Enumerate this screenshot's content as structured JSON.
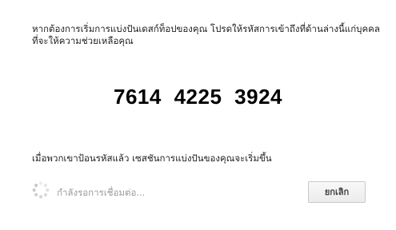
{
  "instruction": "หากต้องการเริ่มการแบ่งปันเดสก์ท็อปของคุณ โปรดให้รหัสการเข้าถึงที่ด้านล่างนี้แก่บุคคลที่จะให้ความช่วยเหลือคุณ",
  "access_code": {
    "groups": [
      "7614",
      "4225",
      "3924"
    ]
  },
  "after_note": "เมื่อพวกเขาป้อนรหัสแล้ว เซสชันการแบ่งปันของคุณจะเริ่มขึ้น",
  "status": {
    "text": "กำลังรอการเชื่อมต่อ...",
    "icon": "spinner-icon"
  },
  "buttons": {
    "cancel_label": "ยกเลิก"
  },
  "colors": {
    "status_text": "#9a9a9a",
    "spinner": "#c8c8c8"
  }
}
